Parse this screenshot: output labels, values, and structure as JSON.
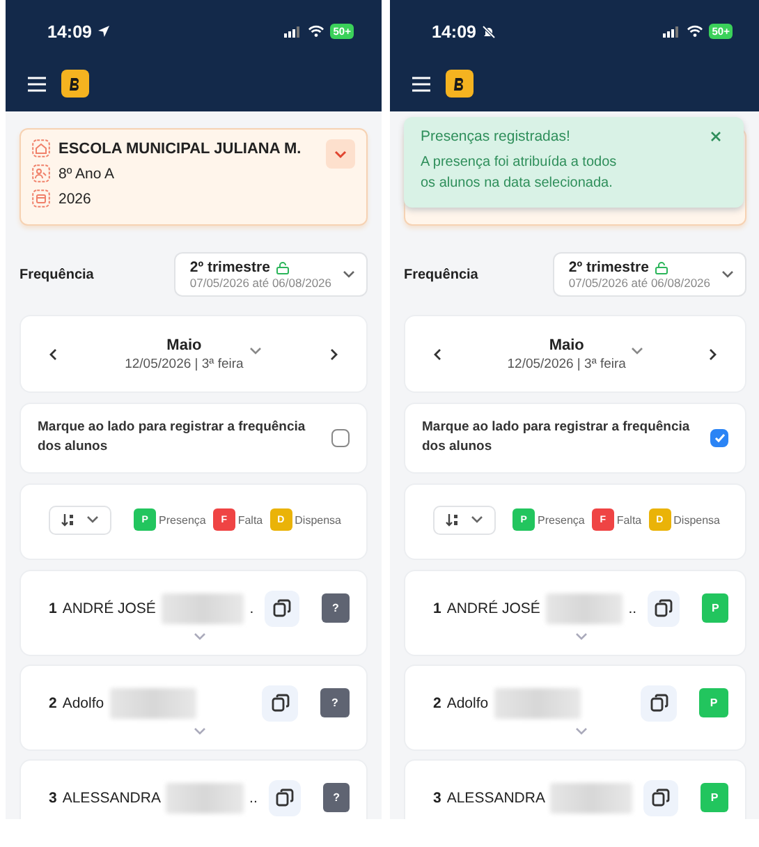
{
  "screens": [
    {
      "status_bar": {
        "time": "14:09",
        "indicator": {
          "kind": "location"
        },
        "battery": "50+"
      },
      "school_card": {
        "school": "ESCOLA MUNICIPAL JULIANA M.",
        "class": "8º Ano A",
        "year": "2026"
      },
      "attendance_label": "Frequência",
      "term": {
        "title": "2º trimestre",
        "range": "07/05/2026 até 06/08/2026"
      },
      "month": {
        "name": "Maio",
        "date": "12/05/2026 | 3ª feira"
      },
      "register": {
        "text": "Marque ao lado para registrar a frequência dos alunos",
        "checked": false
      },
      "legend": [
        {
          "letter": "P",
          "label": "Presença",
          "color": "#22c55e"
        },
        {
          "letter": "F",
          "label": "Falta",
          "color": "#ef4444"
        },
        {
          "letter": "D",
          "label": "Dispensa",
          "color": "#eab308"
        }
      ],
      "students": [
        {
          "number": "1",
          "name": "ANDRÉ JOSÉ",
          "suffix": ".",
          "mark": "?",
          "kind": "unmarked",
          "expandable": true
        },
        {
          "number": "2",
          "name": "Adolfo",
          "mark": "?",
          "kind": "unmarked",
          "expandable": true
        },
        {
          "number": "3",
          "name": "ALESSANDRA",
          "suffix": "..",
          "mark": "?",
          "kind": "unmarked"
        }
      ]
    },
    {
      "status_bar": {
        "time": "14:09",
        "indicator": {
          "kind": "silent"
        },
        "battery": "50+"
      },
      "toast": {
        "title": "Presenças registradas!",
        "message": "A presença foi atribuída a todos os alunos na data selecionada."
      },
      "attendance_label": "Frequência",
      "term": {
        "title": "2º trimestre",
        "range": "07/05/2026 até 06/08/2026"
      },
      "month": {
        "name": "Maio",
        "date": "12/05/2026 | 3ª feira"
      },
      "register": {
        "text": "Marque ao lado para registrar a frequência dos alunos",
        "checked": true
      },
      "legend": [
        {
          "letter": "P",
          "label": "Presença",
          "color": "#22c55e"
        },
        {
          "letter": "F",
          "label": "Falta",
          "color": "#ef4444"
        },
        {
          "letter": "D",
          "label": "Dispensa",
          "color": "#eab308"
        }
      ],
      "students": [
        {
          "number": "1",
          "name": "ANDRÉ JOSÉ",
          "suffix": "..",
          "mark": "P",
          "kind": "present",
          "expandable": true
        },
        {
          "number": "2",
          "name": "Adolfo",
          "mark": "P",
          "kind": "present",
          "expandable": true
        },
        {
          "number": "3",
          "name": "ALESSANDRA",
          "mark": "P",
          "kind": "present"
        }
      ]
    }
  ]
}
